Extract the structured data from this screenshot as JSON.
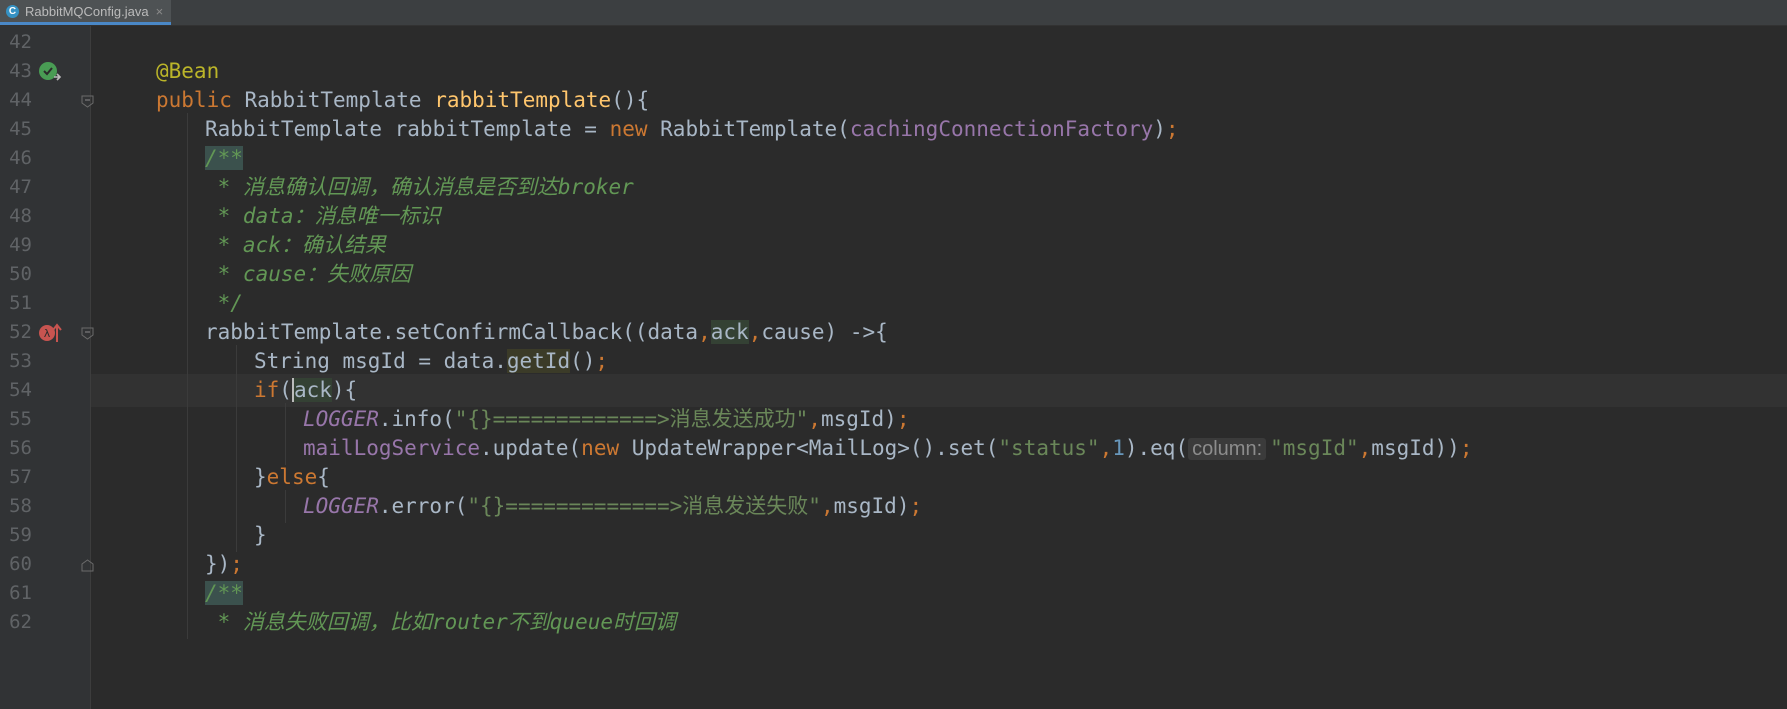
{
  "tab": {
    "icon": "C",
    "file_name": "RabbitMQConfig.java",
    "close_glyph": "×"
  },
  "lines": {
    "l42": {
      "num": "42"
    },
    "l43": {
      "num": "43",
      "text": "@Bean"
    },
    "l44": {
      "num": "44",
      "kw": "public",
      "type": "RabbitTemplate",
      "method": "rabbitTemplate",
      "rest": "(){"
    },
    "l45": {
      "num": "45",
      "a": "RabbitTemplate rabbitTemplate = ",
      "kw": "new",
      "b": " RabbitTemplate(",
      "field": "cachingConnectionFactory",
      "c": ")",
      "semi": ";"
    },
    "l46": {
      "num": "46",
      "text": "/**"
    },
    "l47": {
      "num": "47",
      "text": " * 消息确认回调，确认消息是否到达broker"
    },
    "l48": {
      "num": "48",
      "text": " * data：消息唯一标识"
    },
    "l49": {
      "num": "49",
      "text": " * ack：确认结果"
    },
    "l50": {
      "num": "50",
      "text": " * cause：失败原因"
    },
    "l51": {
      "num": "51",
      "text": " */"
    },
    "l52": {
      "num": "52",
      "a": "rabbitTemplate.setConfirmCallback((data",
      "comma1": ",",
      "ack": "ack",
      "comma2": ",",
      "b": "cause) ->{"
    },
    "l53": {
      "num": "53",
      "a": "String msgId = data.",
      "method": "getId",
      "b": "()",
      "semi": ";"
    },
    "l54": {
      "num": "54",
      "kw": "if",
      "paren": "(",
      "ack": "ack",
      "b": "){"
    },
    "l55": {
      "num": "55",
      "logger": "LOGGER",
      "a": ".info(",
      "str": "\"{}=============>消息发送成功\"",
      "comma": ",",
      "b": "msgId)",
      "semi": ";"
    },
    "l56": {
      "num": "56",
      "field": "mailLogService",
      "a": ".update(",
      "kw": "new",
      "b": " UpdateWrapper<MailLog>().set(",
      "str1": "\"status\"",
      "comma1": ",",
      "num1": "1",
      "c": ").eq(",
      "hint": "column:",
      "str2": "\"msgId\"",
      "comma2": ",",
      "d": "msgId))",
      "semi": ";"
    },
    "l57": {
      "num": "57",
      "a": "}",
      "kw": "else",
      "b": "{"
    },
    "l58": {
      "num": "58",
      "logger": "LOGGER",
      "a": ".error(",
      "str": "\"{}=============>消息发送失败\"",
      "comma": ",",
      "b": "msgId)",
      "semi": ";"
    },
    "l59": {
      "num": "59",
      "text": "}"
    },
    "l60": {
      "num": "60",
      "a": "})",
      "semi": ";"
    },
    "l61": {
      "num": "61",
      "text": "/**"
    },
    "l62": {
      "num": "62",
      "text": " * 消息失败回调，比如router不到queue时回调"
    }
  },
  "colors": {
    "background": "#2b2b2b",
    "keyword": "#cc7832",
    "annotation": "#bbb529",
    "method_decl": "#ffc66d",
    "field": "#9876aa",
    "string": "#6a8759",
    "number": "#6897bb",
    "comment": "#629755",
    "default_text": "#a9b7c6",
    "line_number": "#606366",
    "tab_underline": "#4a88c7"
  },
  "icons": {
    "line43": "bean-run-icon",
    "line52": "lambda-implements-icon",
    "folds": [
      "fold-marker-icon"
    ]
  }
}
